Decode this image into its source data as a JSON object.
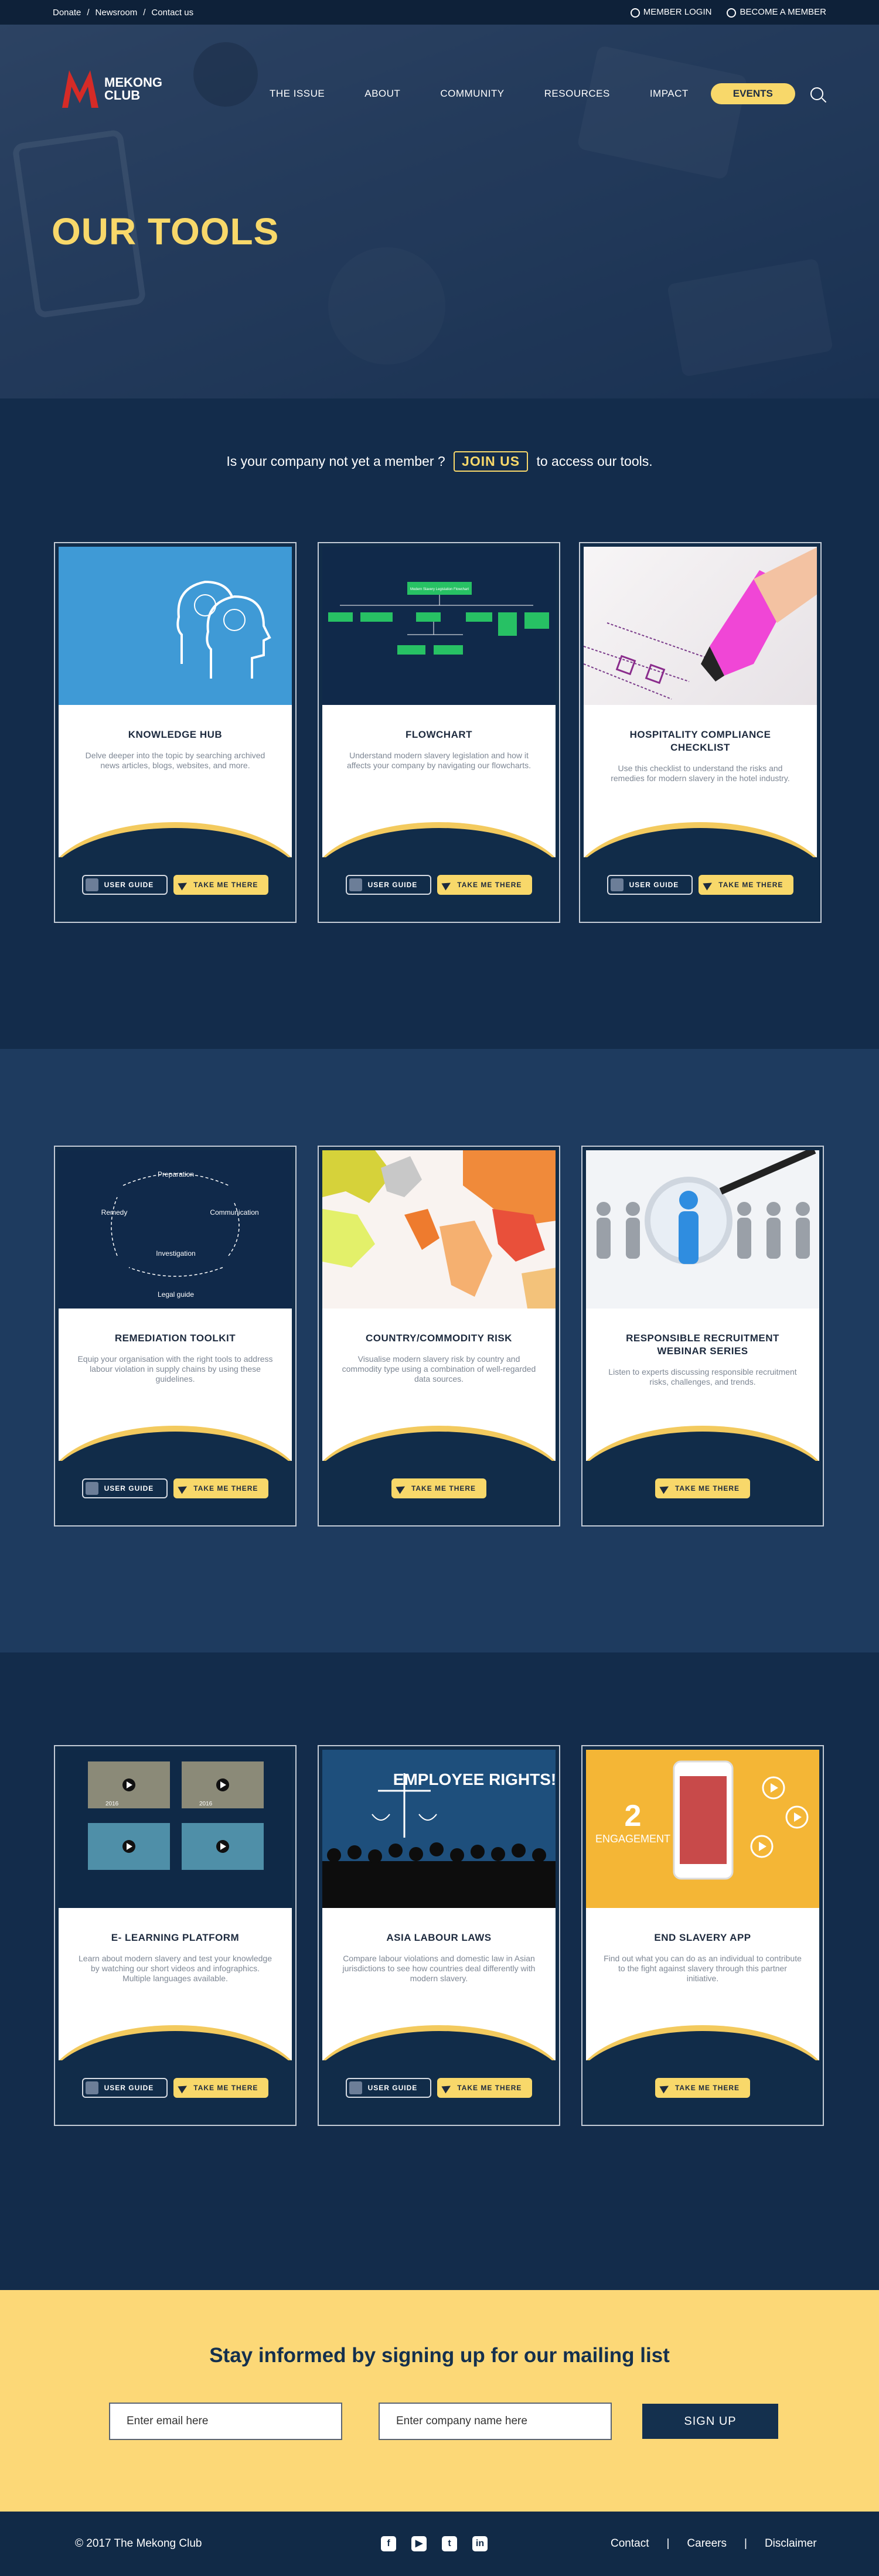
{
  "topbar": {
    "left": [
      "Donate",
      "Newsroom",
      "Contact us"
    ],
    "member_login": "MEMBER LOGIN",
    "become_member": "BECOME A MEMBER"
  },
  "logo": {
    "line1": "MEKONG",
    "line2": "CLUB"
  },
  "nav": {
    "items": [
      "THE ISSUE",
      "ABOUT",
      "COMMUNITY",
      "RESOURCES",
      "IMPACT"
    ],
    "events": "EVENTS"
  },
  "hero": {
    "title": "OUR TOOLS"
  },
  "join": {
    "before": "Is your company not yet a member ?",
    "button": "JOIN US",
    "after": "to access our tools."
  },
  "buttons": {
    "guide": "USER GUIDE",
    "take": "TAKE ME THERE"
  },
  "cards": [
    {
      "title": "KNOWLEDGE HUB",
      "desc": "Delve deeper into the topic by searching archived news articles, blogs, websites, and more."
    },
    {
      "title": "FLOWCHART",
      "desc": "Understand modern slavery legislation and how it affects your company by navigating our flowcharts."
    },
    {
      "title": "HOSPITALITY COMPLIANCE CHECKLIST",
      "desc": "Use this checklist to understand the risks and remedies for modern slavery in the hotel industry."
    },
    {
      "title": "REMEDIATION TOOLKIT",
      "desc": "Equip your organisation with the right tools to address labour violation in supply chains by using these guidelines."
    },
    {
      "title": "COUNTRY/COMMODITY RISK",
      "desc": "Visualise modern slavery risk by country and commodity type using a combination of well-regarded data sources."
    },
    {
      "title": "RESPONSIBLE RECRUITMENT WEBINAR SERIES",
      "desc": "Listen to experts discussing responsible recruitment risks, challenges, and trends."
    },
    {
      "title": "E- LEARNING PLATFORM",
      "desc": "Learn about modern slavery and test your knowledge by watching our short videos and infographics. Multiple languages available."
    },
    {
      "title": "ASIA LABOUR LAWS",
      "desc": "Compare labour violations and domestic law in Asian jurisdictions to see how countries deal differently with modern slavery."
    },
    {
      "title": "END SLAVERY APP",
      "desc": "Find out what you can do as an individual to contribute to the fight against slavery through this partner initiative."
    }
  ],
  "art": {
    "flow_top": "Modern Slavery Legislation Flowchart",
    "remediation": [
      "Preparation",
      "Remedy",
      "Communication",
      "Investigation",
      "Legal guide"
    ],
    "video_year": "2016",
    "chalk": "EMPLOYEE RIGHTS!",
    "app_num": "2",
    "app_word": "ENGAGEMENT"
  },
  "mailing": {
    "title": "Stay informed by signing up for our mailing list",
    "email_placeholder": "Enter email here",
    "company_placeholder": "Enter  company name here",
    "signup": "SIGN UP"
  },
  "footer": {
    "copy": "© 2017 The Mekong Club",
    "links": [
      "Contact",
      "Careers",
      "Disclaimer"
    ]
  },
  "colors": {
    "accent": "#f8d86a",
    "navy": "#132c4b",
    "red": "#d52b27"
  }
}
